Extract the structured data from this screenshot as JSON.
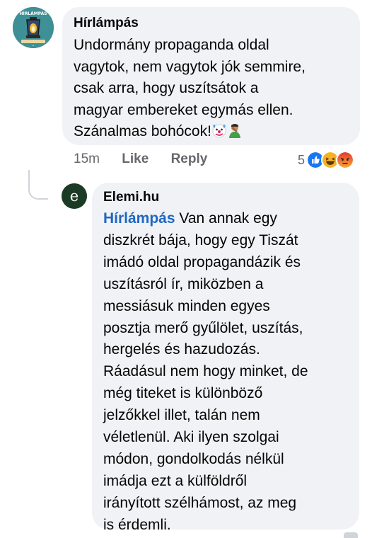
{
  "comment": {
    "author": "Hírlámpás",
    "avatar_text": "HÍRLÁMPÁS",
    "lines": [
      "Undormány propaganda oldal",
      "vagytok, nem vagytok jók semmire,",
      "csak arra, hogy uszítsátok a",
      "magyar embereket egymás ellen.",
      "Szánalmas bohócok!"
    ],
    "emojis": [
      "clown-face",
      "person-facepalming"
    ],
    "time": "15m",
    "like_label": "Like",
    "reply_label": "Reply",
    "reaction_count": "5",
    "reactions": [
      "like",
      "haha",
      "angry"
    ]
  },
  "reply": {
    "author": "Elemi.hu",
    "avatar_letter": "e",
    "mention": "Hírlámpás",
    "first_line_rest": " Van annak egy",
    "lines": [
      "diszkrét bája, hogy egy Tiszát",
      "imádó oldal propagandázik és",
      "uszításról ír, miközben a",
      "messiásuk minden egyes",
      "posztja merő gyűlölet, uszítás,",
      "hergelés és hazudozás.",
      "Ráadásul nem hogy minket, de",
      "még titeket is különböző",
      "jelzőkkel illet, talán nem",
      "véletlenül. Aki ilyen szolgai",
      "módon, gondolkodás nélkül",
      "imádja ezt a külföldről",
      "irányított szélhámost, az meg",
      "is érdemli."
    ]
  },
  "colors": {
    "bubble": "#f0f2f5",
    "mention": "#1f67c1",
    "meta": "#65676b",
    "like": "#1877f2",
    "haha": "#f7b125",
    "angry": "#e9710f"
  }
}
